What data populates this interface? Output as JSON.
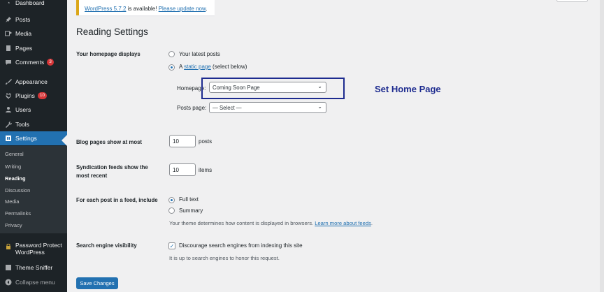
{
  "sidebar": {
    "items": [
      {
        "label": "Dashboard",
        "icon": "gauge-icon"
      },
      {
        "label": "Posts",
        "icon": "pin-icon"
      },
      {
        "label": "Media",
        "icon": "media-icon"
      },
      {
        "label": "Pages",
        "icon": "page-icon"
      },
      {
        "label": "Comments",
        "icon": "comment-icon",
        "badge": "3"
      },
      {
        "label": "Appearance",
        "icon": "brush-icon"
      },
      {
        "label": "Plugins",
        "icon": "plug-icon",
        "badge": "10"
      },
      {
        "label": "Users",
        "icon": "user-icon"
      },
      {
        "label": "Tools",
        "icon": "wrench-icon"
      },
      {
        "label": "Settings",
        "icon": "settings-icon"
      }
    ],
    "submenu": [
      "General",
      "Writing",
      "Reading",
      "Discussion",
      "Media",
      "Permalinks",
      "Privacy"
    ],
    "submenu_current": "Reading",
    "plugin_items": [
      {
        "label_line1": "Password Protect",
        "label_line2": "WordPress",
        "icon": "lock-icon"
      },
      {
        "label": "Theme Sniffer",
        "icon": "sniffer-icon"
      }
    ],
    "collapse_label": "Collapse menu"
  },
  "notice": {
    "text_prefix": "WordPress 5.7.2",
    "text_middle": " is available! ",
    "link_text": "Please update now",
    "text_suffix": "."
  },
  "page_title": "Reading Settings",
  "homepage": {
    "label": "Your homepage displays",
    "option_latest": "Your latest posts",
    "option_static_prefix": "A ",
    "option_static_link": "static page",
    "option_static_suffix": " (select below)",
    "selected": "static",
    "homepage_label": "Homepage:",
    "homepage_value": "Coming Soon Page",
    "posts_page_label": "Posts page:",
    "posts_page_value": "— Select —"
  },
  "blog_pages": {
    "label": "Blog pages show at most",
    "value": "10",
    "unit": "posts"
  },
  "syndication": {
    "label_line1": "Syndication feeds show the",
    "label_line2": "most recent",
    "value": "10",
    "unit": "items"
  },
  "feed_content": {
    "label": "For each post in a feed, include",
    "option_full": "Full text",
    "option_summary": "Summary",
    "selected": "full",
    "desc_prefix": "Your theme determines how content is displayed in browsers. ",
    "desc_link": "Learn more about feeds",
    "desc_suffix": "."
  },
  "search_visibility": {
    "label": "Search engine visibility",
    "checkbox_label": "Discourage search engines from indexing this site",
    "checked": true,
    "desc": "It is up to search engines to honor this request."
  },
  "save_button": "Save Changes",
  "annotation": {
    "text": "Set Home Page",
    "color": "#1d2b8f"
  },
  "colors": {
    "accent": "#2271b1",
    "sidebar": "#1d2327",
    "badge": "#d63638",
    "notice_border": "#dba617"
  }
}
